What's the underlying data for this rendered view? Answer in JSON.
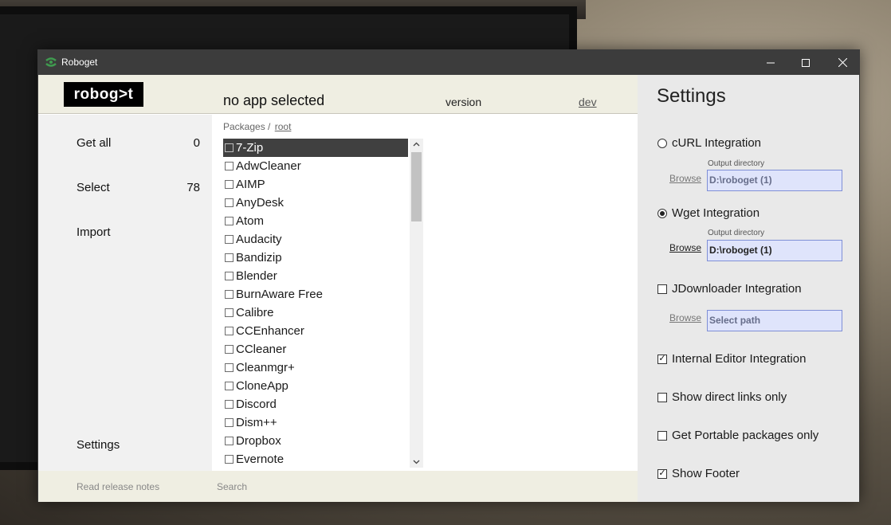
{
  "window": {
    "title": "Roboget",
    "accent": "#3f9b4f"
  },
  "header": {
    "logo": "robog>t",
    "app_selected": "no app selected",
    "version_label": "version",
    "dev_link": "dev"
  },
  "sidebar": {
    "items": [
      {
        "label": "Get all",
        "count": "0"
      },
      {
        "label": "Select",
        "count": "78"
      },
      {
        "label": "Import",
        "count": ""
      }
    ],
    "settings": "Settings"
  },
  "packages": {
    "breadcrumb_label": "Packages /",
    "breadcrumb_root": "root",
    "selected": "7-Zip",
    "items": [
      "7-Zip",
      "AdwCleaner",
      "AIMP",
      "AnyDesk",
      "Atom",
      "Audacity",
      "Bandizip",
      "Blender",
      "BurnAware Free",
      "Calibre",
      "CCEnhancer",
      "CCleaner",
      "Cleanmgr+",
      "CloneApp",
      "Discord",
      "Dism++",
      "Dropbox",
      "Evernote"
    ]
  },
  "footer": {
    "release_notes": "Read release notes",
    "search": "Search"
  },
  "settings": {
    "title": "Settings",
    "curl": {
      "label": "cURL Integration",
      "selected": false,
      "output_label": "Output directory",
      "browse": "Browse",
      "path": "D:\\roboget (1)"
    },
    "wget": {
      "label": "Wget Integration",
      "selected": true,
      "output_label": "Output directory",
      "browse": "Browse",
      "path": "D:\\roboget (1)"
    },
    "jdownloader": {
      "label": "JDownloader Integration",
      "checked": false,
      "browse": "Browse",
      "path": "Select path"
    },
    "internal_editor": {
      "label": "Internal Editor Integration",
      "checked": true
    },
    "direct_links": {
      "label": "Show direct links only",
      "checked": false
    },
    "portable": {
      "label": "Get Portable packages only",
      "checked": false
    },
    "footer": {
      "label": "Show Footer",
      "checked": true
    }
  }
}
